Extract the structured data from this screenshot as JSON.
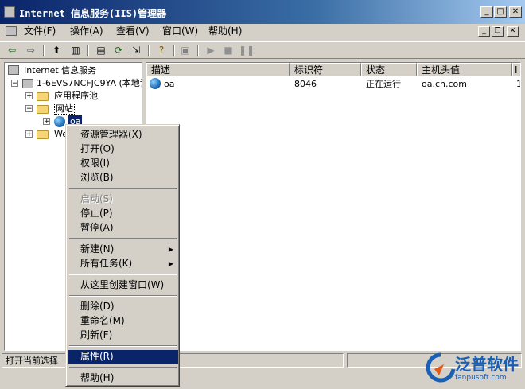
{
  "window": {
    "title": "Internet 信息服务(IIS)管理器"
  },
  "menubar": {
    "items": [
      "文件(F)",
      "操作(A)",
      "查看(V)",
      "窗口(W)",
      "帮助(H)"
    ]
  },
  "toolbar": {
    "icons": [
      "back-arrow-icon",
      "forward-arrow-icon",
      "up-folder-icon",
      "show-tree-icon",
      "properties-icon",
      "refresh-icon",
      "export-icon",
      "help-icon",
      "computer-icon",
      "play-icon",
      "stop-icon",
      "pause-icon"
    ]
  },
  "tree": {
    "root": "Internet 信息服务",
    "computer": "1-6EVS7NCFJC9YA (本地计",
    "app_pools": "应用程序池",
    "websites": "网站",
    "site_oa": "oa",
    "web_ext": "We"
  },
  "list": {
    "columns": [
      "描述",
      "标识符",
      "状态",
      "主机头值",
      "I"
    ],
    "rows": [
      {
        "description": "oa",
        "id": "8046",
        "status": "正在运行",
        "host": "oa.cn.com",
        "extra": "1"
      }
    ]
  },
  "context_menu": {
    "items": [
      {
        "label": "资源管理器(X)",
        "enabled": true
      },
      {
        "label": "打开(O)",
        "enabled": true
      },
      {
        "label": "权限(I)",
        "enabled": true
      },
      {
        "label": "浏览(B)",
        "enabled": true
      },
      {
        "label": "启动(S)",
        "enabled": false
      },
      {
        "label": "停止(P)",
        "enabled": true
      },
      {
        "label": "暂停(A)",
        "enabled": true
      },
      {
        "label": "新建(N)",
        "enabled": true,
        "submenu": true
      },
      {
        "label": "所有任务(K)",
        "enabled": true,
        "submenu": true
      },
      {
        "label": "从这里创建窗口(W)",
        "enabled": true
      },
      {
        "label": "删除(D)",
        "enabled": true
      },
      {
        "label": "重命名(M)",
        "enabled": true
      },
      {
        "label": "刷新(F)",
        "enabled": true
      },
      {
        "label": "属性(R)",
        "enabled": true,
        "selected": true
      },
      {
        "label": "帮助(H)",
        "enabled": true
      }
    ]
  },
  "statusbar": {
    "text": "打开当前选择"
  },
  "logo": {
    "text": "泛普软件",
    "url": "fanpusoft.com"
  },
  "colors": {
    "title_bar": "#0a246a",
    "highlight": "#0a246a",
    "face": "#d4d0c8",
    "logo": "#1a5fb4"
  }
}
